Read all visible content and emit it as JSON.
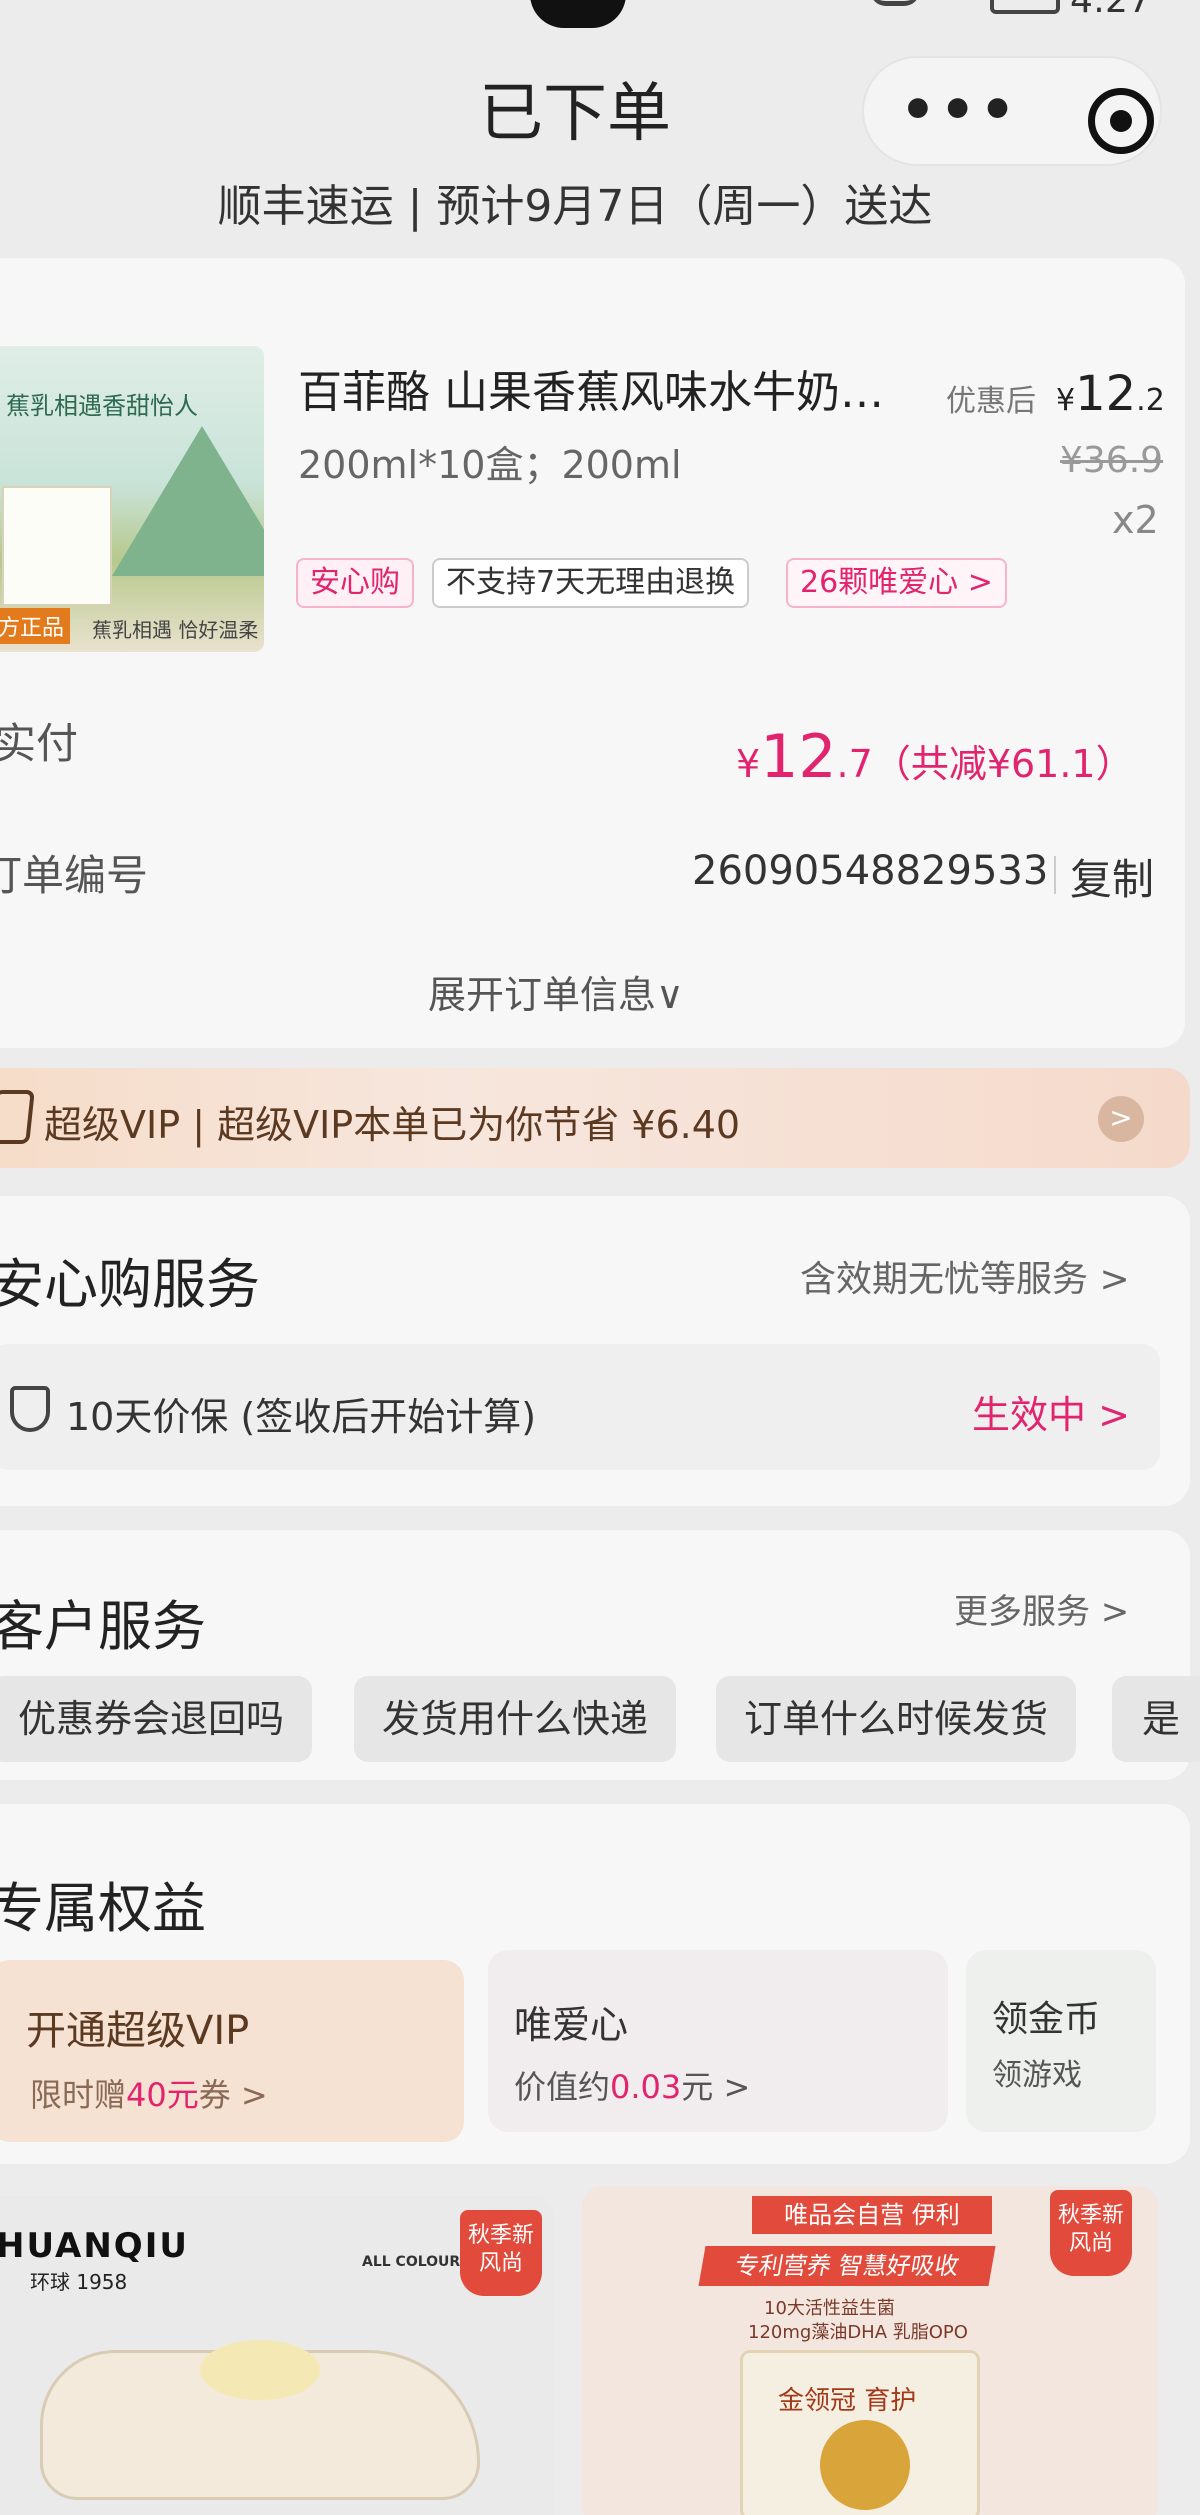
{
  "status_bar": {
    "time": "4:27"
  },
  "header": {
    "title": "已下单",
    "subtitle": "顺丰速运 | 预计9月7日（周一）送达"
  },
  "product": {
    "image_text_top": "蕉乳相遇香甜怡人",
    "image_tag": "方正品",
    "image_text_bottom": "蕉乳相遇 恰好温柔",
    "name": "百菲酪 山果香蕉风味水牛奶…",
    "spec": "200ml*10盒；200ml",
    "discount_label": "优惠后",
    "price_now_currency": "¥",
    "price_now_int": "12",
    "price_now_dec": ".2",
    "price_original": "¥36.9",
    "quantity": "x2",
    "chips": [
      "安心购",
      "不支持7天无理由退换",
      "26颗唯爱心 >"
    ]
  },
  "payment": {
    "paid_label": "实付",
    "paid_currency": "¥",
    "paid_int": "12",
    "paid_dec": ".7",
    "paid_saved": "（共减¥61.1）",
    "order_label": "订单编号",
    "order_number": "26090548829533",
    "copy_label": "复制",
    "expand_label": "展开订单信息∨"
  },
  "vip_banner": {
    "text": "超级VIP | 超级VIP本单已为你节省 ¥6.40",
    "arrow": ">"
  },
  "service": {
    "title": "安心购服务",
    "link": "含效期无忧等服务 >",
    "item": "10天价保 (签收后开始计算)",
    "status": "生效中 >"
  },
  "customer_service": {
    "title": "客户服务",
    "link": "更多服务 >",
    "questions": [
      "优惠券会退回吗",
      "发货用什么快递",
      "订单什么时候发货",
      "是"
    ]
  },
  "benefits": {
    "title": "专属权益",
    "vip": {
      "title": "开通超级VIP",
      "sub_prefix": "限时赠",
      "sub_highlight": "40元",
      "sub_suffix": "券 >"
    },
    "heart": {
      "title": "唯爱心",
      "sub_prefix": "价值约",
      "sub_highlight": "0.03",
      "sub_suffix": "元 >"
    },
    "coin": {
      "title": "领金币",
      "sub": "领游戏"
    }
  },
  "recommend": {
    "left": {
      "brand": "HUANQIU",
      "brand_sub": "环球 1958",
      "allcolour": "ALL COLOUR",
      "badge": "秋季新风尚"
    },
    "right": {
      "top": "唯品会自营 伊利",
      "banner": "专利营养 智慧好吸收",
      "line1": "10大活性益生菌",
      "line2": "120mg藻油DHA 乳脂OPO",
      "brand": "金领冠 育护",
      "badge": "秋季新风尚"
    }
  }
}
